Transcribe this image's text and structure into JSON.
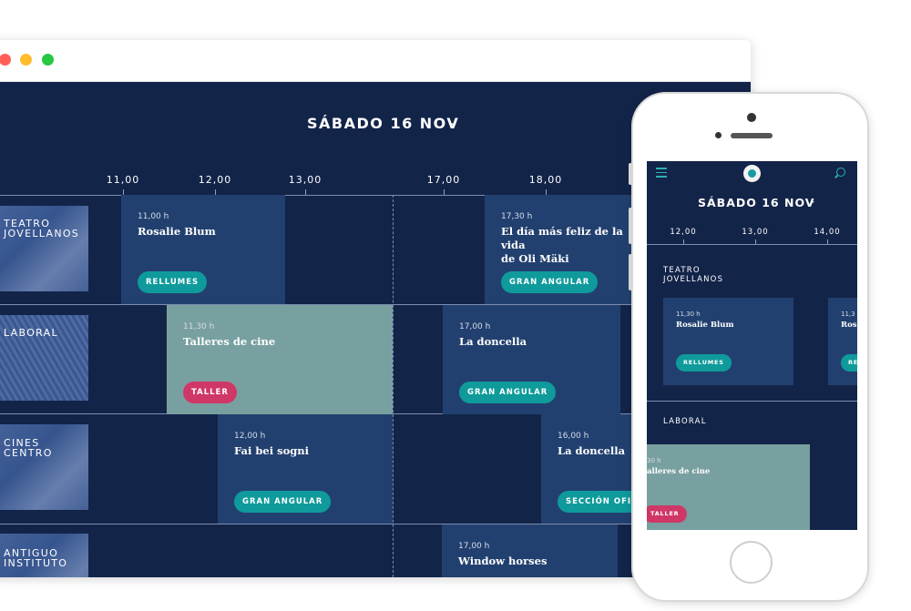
{
  "desktop": {
    "day": "SÁBADO 16 NOV",
    "ticks": [
      "11,00",
      "12,00",
      "13,00",
      "17,00",
      "18,00"
    ],
    "venues": [
      {
        "label": "TEATRO\nJOVELLANOS"
      },
      {
        "label": "LABORAL"
      },
      {
        "label": "CINES\nCENTRO"
      },
      {
        "label": "ANTIGUO\nINSTITUTO"
      }
    ],
    "events": [
      {
        "time": "11,00 h",
        "title": "Rosalie Blum",
        "tag": "RELLUMES"
      },
      {
        "time": "17,30 h",
        "title": "El día más feliz de la vida\nde Oli Mäki",
        "tag": "GRAN ANGULAR"
      },
      {
        "time": "11,30 h",
        "title": "Talleres de cine",
        "tag": "TALLER"
      },
      {
        "time": "17,00 h",
        "title": "La doncella",
        "tag": "GRAN ANGULAR"
      },
      {
        "time": "12,00 h",
        "title": "Fai bei sogni",
        "tag": "GRAN ANGULAR"
      },
      {
        "time": "16,00 h",
        "title": "La doncella",
        "tag": "SECCIÓN OFICI"
      },
      {
        "time": "17,00 h",
        "title": "Window horses"
      }
    ]
  },
  "mobile": {
    "day": "SÁBADO 16 NOV",
    "ticks": [
      "12,00",
      "13,00",
      "14,00"
    ],
    "venues": [
      {
        "label": "TEATRO\nJOVELLANOS"
      },
      {
        "label": "LABORAL"
      }
    ],
    "events": [
      {
        "time": "11,30 h",
        "title": "Rosalie Blum",
        "tag": "RELLUMES"
      },
      {
        "time": "11,3",
        "title": "Ros",
        "tag": "RE"
      },
      {
        "time": "30 h",
        "title": "alleres de cine",
        "tag": "TALLER"
      }
    ]
  },
  "icons": {
    "chevron": "chevron-down-icon",
    "menu": "hamburger-menu-icon",
    "logo": "eye-logo-icon",
    "search": "search-icon"
  },
  "colors": {
    "background": "#132449",
    "event": "#22406f",
    "event_highlight": "#79a0a0",
    "tag_teal": "#0f9a9b",
    "tag_pink": "#cf3767"
  }
}
